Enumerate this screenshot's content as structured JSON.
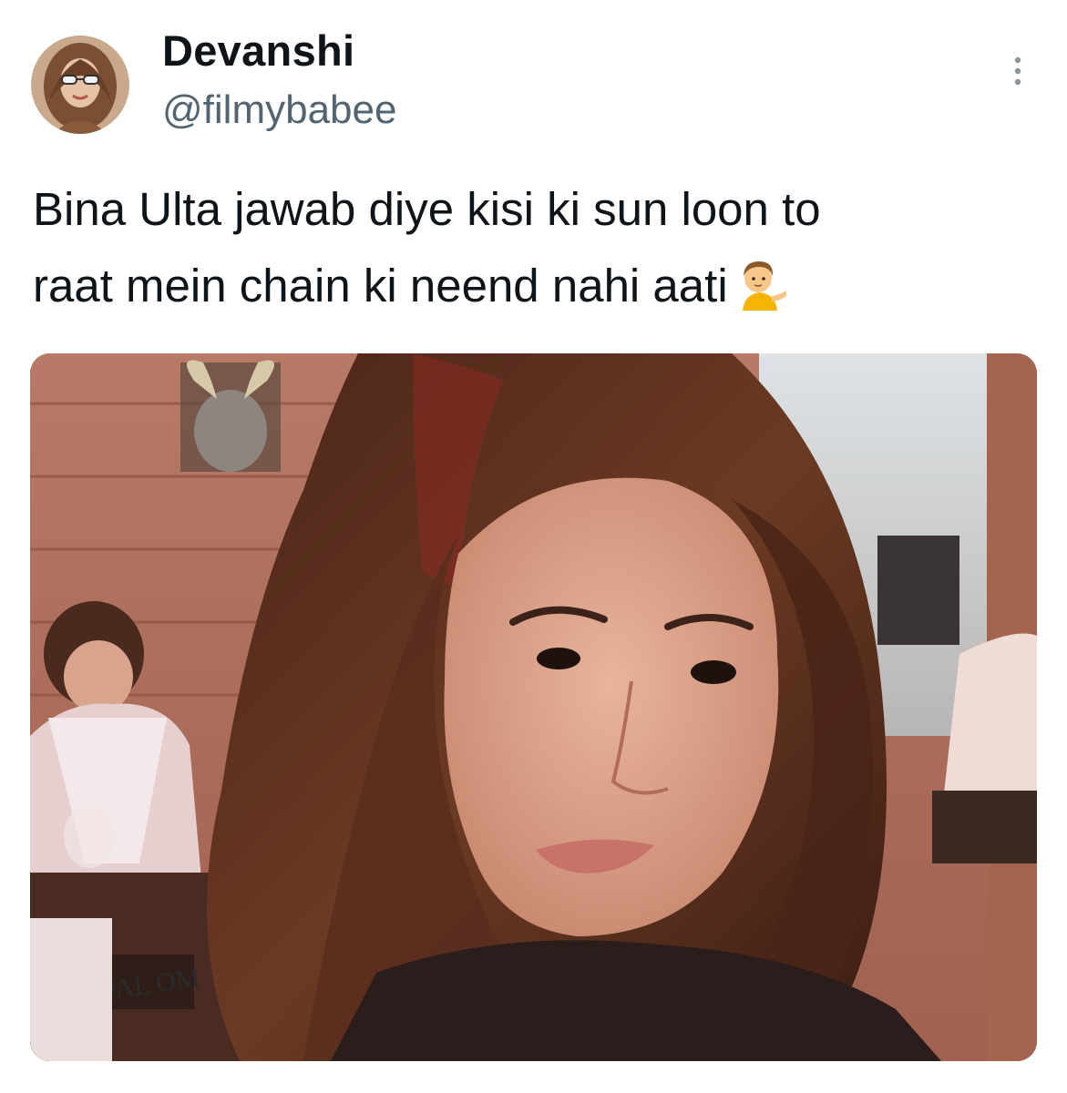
{
  "tweet": {
    "author": {
      "display_name": "Devanshi",
      "handle": "@filmybabee"
    },
    "text_lines": [
      "Bina Ulta jawab diye kisi ki sun loon to",
      "raat mein chain ki neend nahi aati"
    ],
    "emoji": "person-tipping-hand-icon",
    "menu_icon": "more-options-icon",
    "media": {
      "type": "photo",
      "background_sign_text": "PAL OM"
    }
  },
  "colors": {
    "text_primary": "#0f1419",
    "text_secondary": "#536471",
    "background": "#ffffff"
  }
}
